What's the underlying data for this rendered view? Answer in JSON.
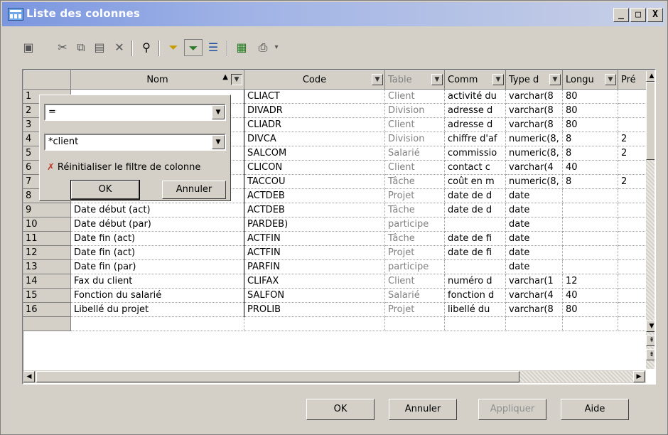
{
  "window": {
    "title": "Liste des colonnes",
    "min": "_",
    "max": "□",
    "close": "X"
  },
  "toolbar": [
    "properties-icon",
    "cut-icon",
    "copy-icon",
    "paste-icon",
    "delete-icon",
    "find-icon",
    "filter-icon",
    "filter-active-icon",
    "customize-columns-icon",
    "excel-export-icon",
    "print-icon",
    "dropdown-arrow-icon"
  ],
  "grid": {
    "headers": [
      "",
      "Nom",
      "Code",
      "Table",
      "Comm",
      "Type d",
      "Longu",
      "Pré"
    ],
    "rows": [
      [
        "1",
        "",
        "CLIACT",
        "Client",
        "activité du",
        "varchar(8",
        "80",
        ""
      ],
      [
        "2",
        "",
        "DIVADR",
        "Division",
        "adresse d",
        "varchar(8",
        "80",
        ""
      ],
      [
        "3",
        "",
        "CLIADR",
        "Client",
        "adresse d",
        "varchar(8",
        "80",
        ""
      ],
      [
        "4",
        "",
        "DIVCA",
        "Division",
        "chiffre d'af",
        "numeric(8,",
        "8",
        "2"
      ],
      [
        "5",
        "",
        "SALCOM",
        "Salarié",
        "commissio",
        "numeric(8,",
        "8",
        "2"
      ],
      [
        "6",
        "",
        "CLICON",
        "Client",
        "contact c",
        "varchar(4",
        "40",
        ""
      ],
      [
        "7",
        "",
        "TACCOU",
        "Tâche",
        "coût en m",
        "numeric(8,",
        "8",
        "2"
      ],
      [
        "8",
        "Date début (act)",
        "ACTDEB",
        "Projet",
        "date de d",
        "date",
        "",
        ""
      ],
      [
        "9",
        "Date début (act)",
        "ACTDEB",
        "Tâche",
        "date de d",
        "date",
        "",
        ""
      ],
      [
        "10",
        "Date début (par)",
        "PARDEB)",
        "participe",
        "",
        "date",
        "",
        ""
      ],
      [
        "11",
        "Date fin (act)",
        "ACTFIN",
        "Tâche",
        "date de fi",
        "date",
        "",
        ""
      ],
      [
        "12",
        "Date fin (act)",
        "ACTFIN",
        "Projet",
        "date de fi",
        "date",
        "",
        ""
      ],
      [
        "13",
        "Date fin (par)",
        "PARFIN",
        "participe",
        "",
        "date",
        "",
        ""
      ],
      [
        "14",
        "Fax du client",
        "CLIFAX",
        "Client",
        "numéro d",
        "varchar(1",
        "12",
        ""
      ],
      [
        "15",
        "Fonction du salarié",
        "SALFON",
        "Salarié",
        "fonction d",
        "varchar(4",
        "40",
        ""
      ],
      [
        "16",
        "Libellé du projet",
        "PROLIB",
        "Projet",
        "libellé du",
        "varchar(8",
        "80",
        ""
      ]
    ]
  },
  "filter_popup": {
    "operator": "=",
    "value": "*client",
    "reset_label": "Réinitialiser le filtre de colonne",
    "ok": "OK",
    "cancel": "Annuler"
  },
  "buttons": {
    "ok": "OK",
    "cancel": "Annuler",
    "apply": "Appliquer",
    "help": "Aide"
  }
}
